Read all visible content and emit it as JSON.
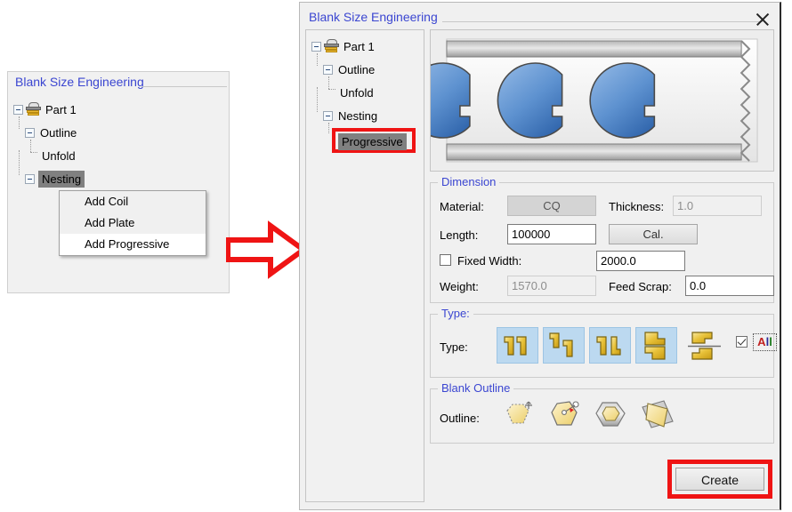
{
  "left_panel": {
    "title": "Blank Size Engineering",
    "tree": [
      {
        "label": "Part 1",
        "icon": "part-stack-icon",
        "expanded": true,
        "selected": false
      },
      {
        "label": "Outline",
        "expanded": true,
        "selected": false
      },
      {
        "label": "Unfold",
        "expanded": false,
        "selected": false
      },
      {
        "label": "Nesting",
        "expanded": true,
        "selected": true
      }
    ],
    "context_menu": {
      "items": [
        {
          "label": "Add Coil",
          "hover": false
        },
        {
          "label": "Add Plate",
          "hover": false
        },
        {
          "label": "Add Progressive",
          "hover": true
        }
      ]
    }
  },
  "arrow": {
    "name": "right-arrow",
    "color": "#ef1414"
  },
  "dialog": {
    "title": "Blank Size Engineering",
    "close_label": "✕",
    "tree": [
      {
        "label": "Part 1",
        "icon": "part-stack-icon",
        "expanded": true,
        "selected": false
      },
      {
        "label": "Outline",
        "expanded": true,
        "selected": false
      },
      {
        "label": "Unfold",
        "expanded": false,
        "selected": false
      },
      {
        "label": "Nesting",
        "expanded": true,
        "selected": false
      },
      {
        "label": "Progressive",
        "expanded": false,
        "selected": true,
        "highlighted": true
      }
    ],
    "preview": {
      "name": "nesting-strip-preview",
      "blank_count": 3
    },
    "dimension": {
      "title": "Dimension",
      "material_label": "Material:",
      "material_value": "CQ",
      "thickness_label": "Thickness:",
      "thickness_value": "1.0",
      "length_label": "Length:",
      "length_value": "100000",
      "cal_label": "Cal.",
      "fixed_width_label": "Fixed Width:",
      "fixed_width_checked": false,
      "fixed_width_value": "2000.0",
      "weight_label": "Weight:",
      "weight_value": "1570.0",
      "feed_scrap_label": "Feed Scrap:",
      "feed_scrap_value": "0.0"
    },
    "type": {
      "title": "Type:",
      "row_label": "Type:",
      "options": [
        {
          "name": "type-two-up-icon",
          "selected": true
        },
        {
          "name": "type-staggered-icon",
          "selected": true
        },
        {
          "name": "type-mirrored-icon",
          "selected": true
        },
        {
          "name": "type-vertical-pair-icon",
          "selected": true
        },
        {
          "name": "type-opposed-icon",
          "selected": false
        }
      ],
      "all_checked": true,
      "all_label": "All"
    },
    "blank_outline": {
      "title": "Blank Outline",
      "row_label": "Outline:",
      "options": [
        {
          "name": "outline-move-icon"
        },
        {
          "name": "outline-edit-node-icon"
        },
        {
          "name": "outline-offset-icon"
        },
        {
          "name": "outline-rotate-icon"
        }
      ]
    },
    "create_label": "Create"
  }
}
